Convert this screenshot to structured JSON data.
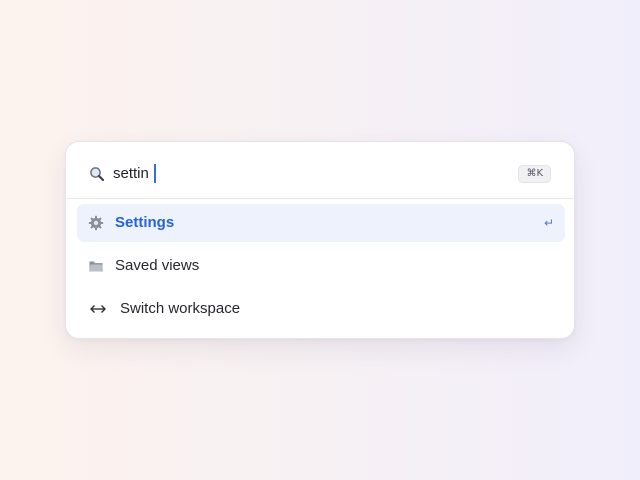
{
  "search": {
    "icon": "search-icon",
    "value": "settin",
    "shortcut": "⌘K"
  },
  "results": [
    {
      "icon": "gear-icon",
      "label": "Settings",
      "selected": true,
      "hint_icon": "return-icon",
      "hint": "↵"
    },
    {
      "icon": "folder-icon",
      "label": "Saved views",
      "selected": false
    },
    {
      "icon": "switch-arrows-icon",
      "label": "Switch workspace",
      "selected": false
    }
  ],
  "colors": {
    "accent": "#2563d6",
    "selected_bg": "#edf2fd",
    "caret": "#2f6fdf"
  }
}
